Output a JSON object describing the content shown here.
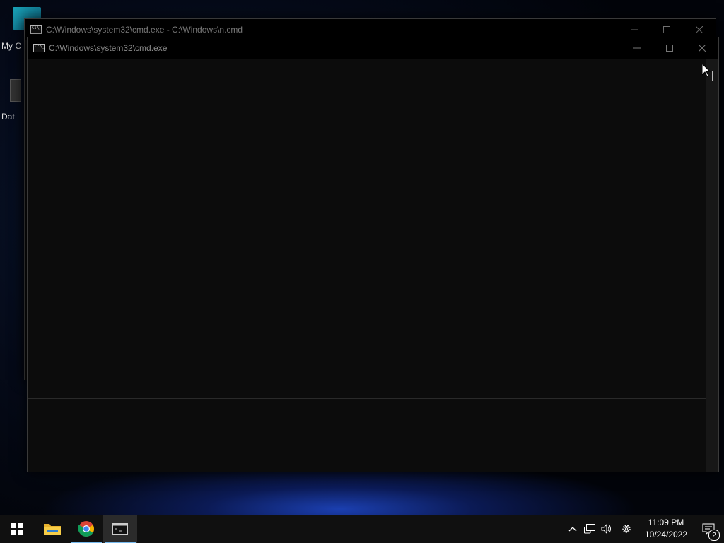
{
  "desktop": {
    "icons": [
      {
        "label": "My C"
      },
      {
        "label": "Dat"
      }
    ]
  },
  "windows": {
    "back": {
      "title": "C:\\Windows\\system32\\cmd.exe - C:\\Windows\\n.cmd"
    },
    "front": {
      "title": "C:\\Windows\\system32\\cmd.exe"
    }
  },
  "taskbar": {
    "apps": [
      {
        "name": "start-icon"
      },
      {
        "name": "file-explorer-icon"
      },
      {
        "name": "chrome-icon"
      },
      {
        "name": "cmd-icon"
      }
    ],
    "tray": {
      "icons": [
        "chevron-up-icon",
        "network-icon",
        "volume-icon",
        "settings-icon"
      ],
      "time": "11:09 PM",
      "date": "10/24/2022",
      "notification_count": "2"
    }
  },
  "colors": {
    "console_bg": "#0c0c0c",
    "taskbar_bg": "#101010",
    "accent": "#76b9ed"
  }
}
